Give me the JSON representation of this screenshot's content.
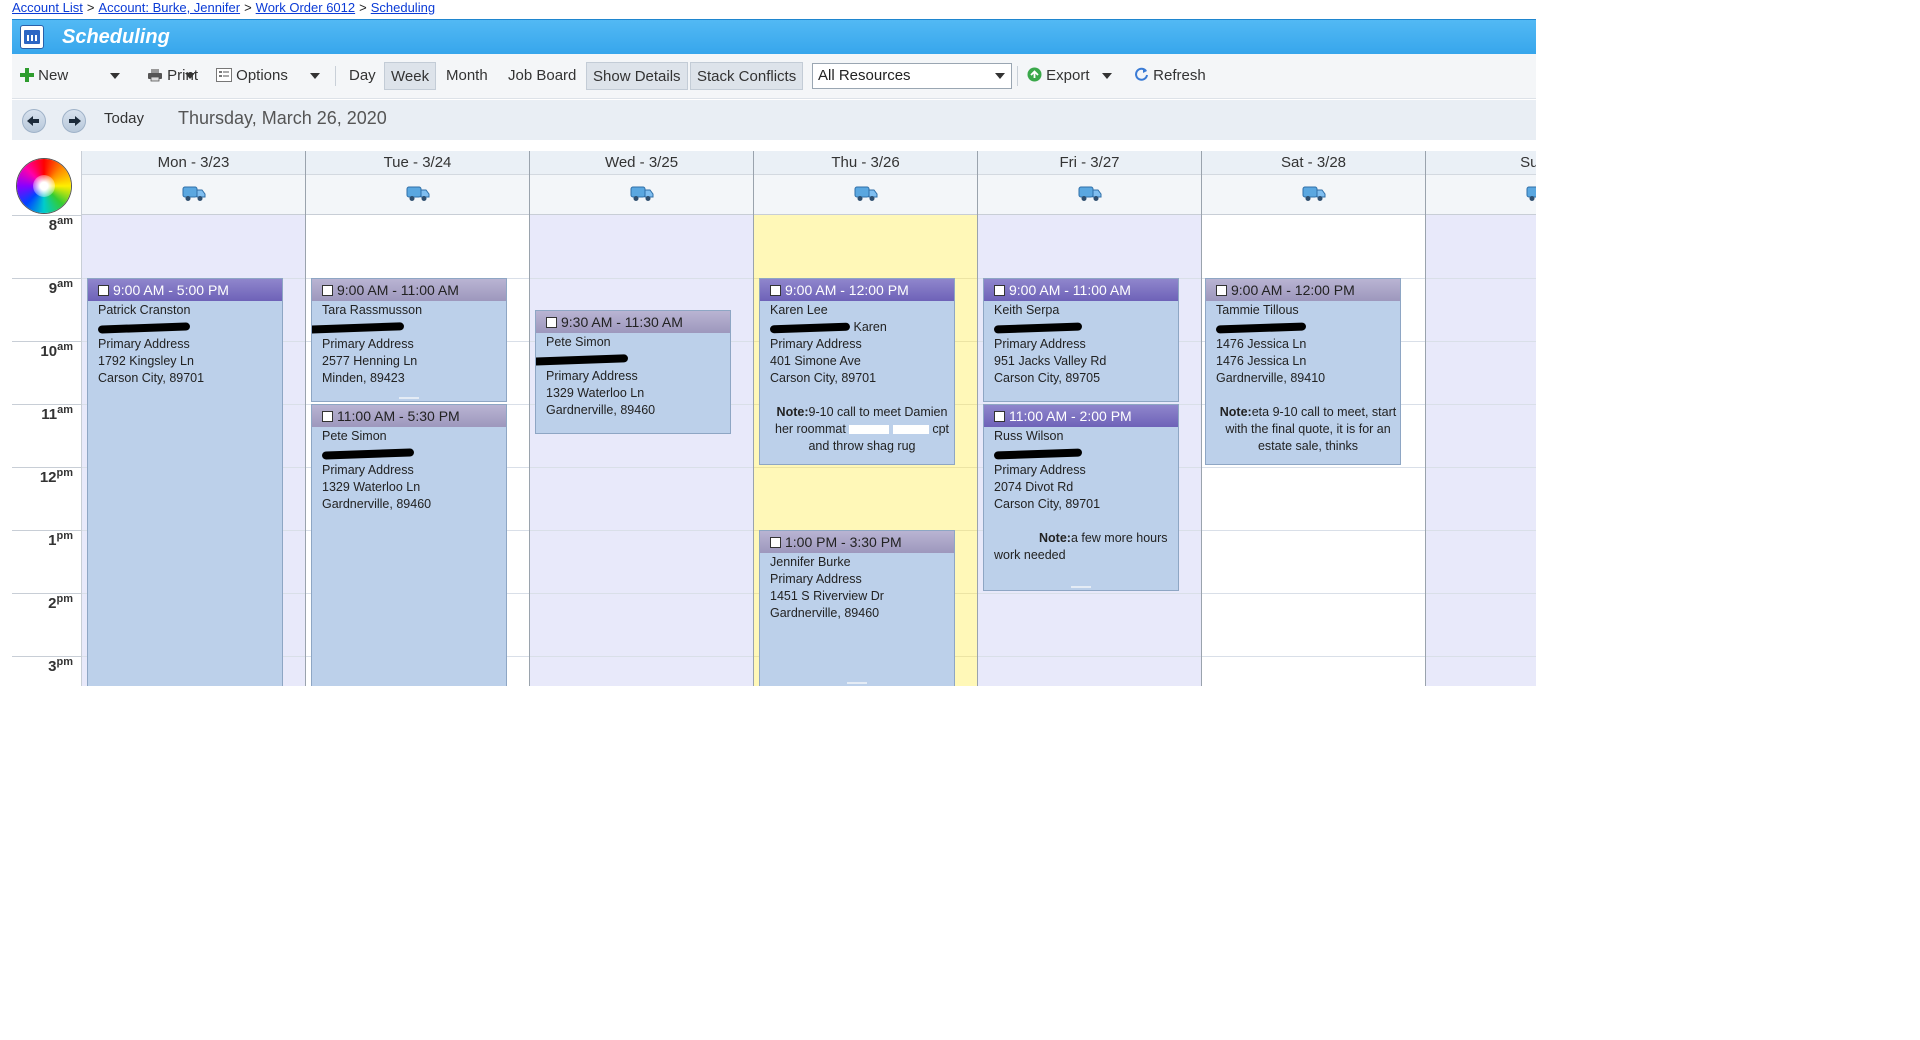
{
  "breadcrumb": [
    {
      "label": "Account List"
    },
    {
      "label": "Account: Burke, Jennifer"
    },
    {
      "label": "Work Order 6012"
    },
    {
      "label": "Scheduling"
    }
  ],
  "header": {
    "title": "Scheduling",
    "icon": "calendar-app-icon"
  },
  "toolbar": {
    "new_label": "New",
    "print_label": "Print",
    "options_label": "Options",
    "day_label": "Day",
    "week_label": "Week",
    "month_label": "Month",
    "job_board_label": "Job Board",
    "show_details_label": "Show Details",
    "stack_conflicts_label": "Stack Conflicts",
    "resources_selected": "All Resources",
    "export_label": "Export",
    "refresh_label": "Refresh",
    "active_view": "Week"
  },
  "datebar": {
    "today_label": "Today",
    "current_date": "Thursday, March 26, 2020"
  },
  "time_labels": [
    {
      "hour": "8",
      "ampm": "am"
    },
    {
      "hour": "9",
      "ampm": "am"
    },
    {
      "hour": "10",
      "ampm": "am"
    },
    {
      "hour": "11",
      "ampm": "am"
    },
    {
      "hour": "12",
      "ampm": "pm"
    },
    {
      "hour": "1",
      "ampm": "pm"
    },
    {
      "hour": "2",
      "ampm": "pm"
    },
    {
      "hour": "3",
      "ampm": "pm"
    }
  ],
  "days": [
    {
      "label": "Mon - 3/23"
    },
    {
      "label": "Tue - 3/24"
    },
    {
      "label": "Wed - 3/25"
    },
    {
      "label": "Thu - 3/26"
    },
    {
      "label": "Fri - 3/27"
    },
    {
      "label": "Sat - 3/28"
    },
    {
      "label": "Sun -"
    }
  ],
  "appointments": {
    "mon_1": {
      "time": "9:00 AM - 5:00 PM",
      "name": "Patrick Cranston",
      "address_label": "Primary Address",
      "street": "1792 Kingsley Ln",
      "city": "Carson City, 89701"
    },
    "tue_1": {
      "time": "9:00 AM - 11:00 AM",
      "name": "Tara Rassmusson",
      "address_label": "Primary Address",
      "street": "2577 Henning Ln",
      "city": "Minden, 89423"
    },
    "tue_2": {
      "time": "11:00 AM - 5:30 PM",
      "name": "Pete Simon",
      "address_label": "Primary Address",
      "street": "1329 Waterloo Ln",
      "city": "Gardnerville, 89460"
    },
    "wed_1": {
      "time": "9:30 AM - 11:30 AM",
      "name": "Pete Simon",
      "address_label": "Primary Address",
      "street": "1329 Waterloo Ln",
      "city": "Gardnerville, 89460"
    },
    "thu_1": {
      "time": "9:00 AM - 12:00 PM",
      "name": "Karen Lee",
      "name2": "Karen",
      "address_label": "Primary Address",
      "street": "401 Simone Ave",
      "city": "Carson City, 89701",
      "note_label": "Note:",
      "note_text": "9-10 call to meet Damien her roommat",
      "note_text2": "cpt and throw shag rug"
    },
    "thu_2": {
      "time": "1:00 PM - 3:30 PM",
      "name": "Jennifer Burke",
      "address_label": "Primary Address",
      "street": "1451 S Riverview Dr",
      "city": "Gardnerville, 89460"
    },
    "fri_1": {
      "time": "9:00 AM - 11:00 AM",
      "name": "Keith Serpa",
      "address_label": "Primary Address",
      "street": "951 Jacks Valley Rd",
      "city": "Carson City, 89705"
    },
    "fri_2": {
      "time": "11:00 AM - 2:00 PM",
      "name": "Russ Wilson",
      "address_label": "Primary Address",
      "street": "2074 Divot Rd",
      "city": "Carson City, 89701",
      "note_label": "Note:",
      "note_text": "a few more hours work needed"
    },
    "sat_1": {
      "time": "9:00 AM - 12:00 PM",
      "name": "Tammie Tillous",
      "street_a": "1476 Jessica Ln",
      "street": "1476 Jessica Ln",
      "city": "Gardnerville, 89410",
      "note_label": "Note:",
      "note_text": "eta 9-10 call to meet, start with the final quote, it is for an estate sale, thinks"
    }
  },
  "colors": {
    "title_bar": "#42aef0",
    "appointment_bg": "#bcd0ea",
    "appointment_head": "#7a6fc0",
    "today_column": "#fff8b8",
    "weekday_shade": "#e8e9fa"
  }
}
